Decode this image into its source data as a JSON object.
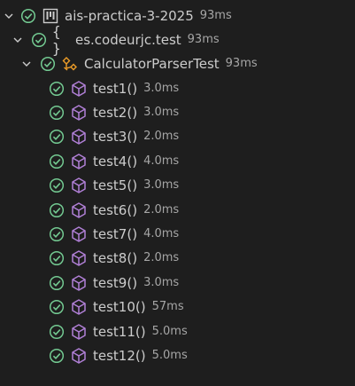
{
  "colors": {
    "pass": "#73c991",
    "method": "#b180d7",
    "class": "#ee9d28",
    "background": "#1e1e1e",
    "text": "#cccccc",
    "muted": "#a6a6a6"
  },
  "project": {
    "name": "ais-practica-3-2025",
    "duration": "93ms",
    "icon": "repo-icon",
    "status": "passed"
  },
  "package": {
    "name": "es.codeurjc.test",
    "duration": "93ms",
    "icon": "braces-icon",
    "status": "passed"
  },
  "test_class": {
    "name": "CalculatorParserTest",
    "duration": "93ms",
    "icon": "class-icon",
    "status": "passed"
  },
  "tests": [
    {
      "name": "test1()",
      "duration": "3.0ms",
      "status": "passed"
    },
    {
      "name": "test2()",
      "duration": "3.0ms",
      "status": "passed"
    },
    {
      "name": "test3()",
      "duration": "2.0ms",
      "status": "passed"
    },
    {
      "name": "test4()",
      "duration": "4.0ms",
      "status": "passed"
    },
    {
      "name": "test5()",
      "duration": "3.0ms",
      "status": "passed"
    },
    {
      "name": "test6()",
      "duration": "2.0ms",
      "status": "passed"
    },
    {
      "name": "test7()",
      "duration": "4.0ms",
      "status": "passed"
    },
    {
      "name": "test8()",
      "duration": "2.0ms",
      "status": "passed"
    },
    {
      "name": "test9()",
      "duration": "3.0ms",
      "status": "passed"
    },
    {
      "name": "test10()",
      "duration": "57ms",
      "status": "passed"
    },
    {
      "name": "test11()",
      "duration": "5.0ms",
      "status": "passed"
    },
    {
      "name": "test12()",
      "duration": "5.0ms",
      "status": "passed"
    }
  ]
}
